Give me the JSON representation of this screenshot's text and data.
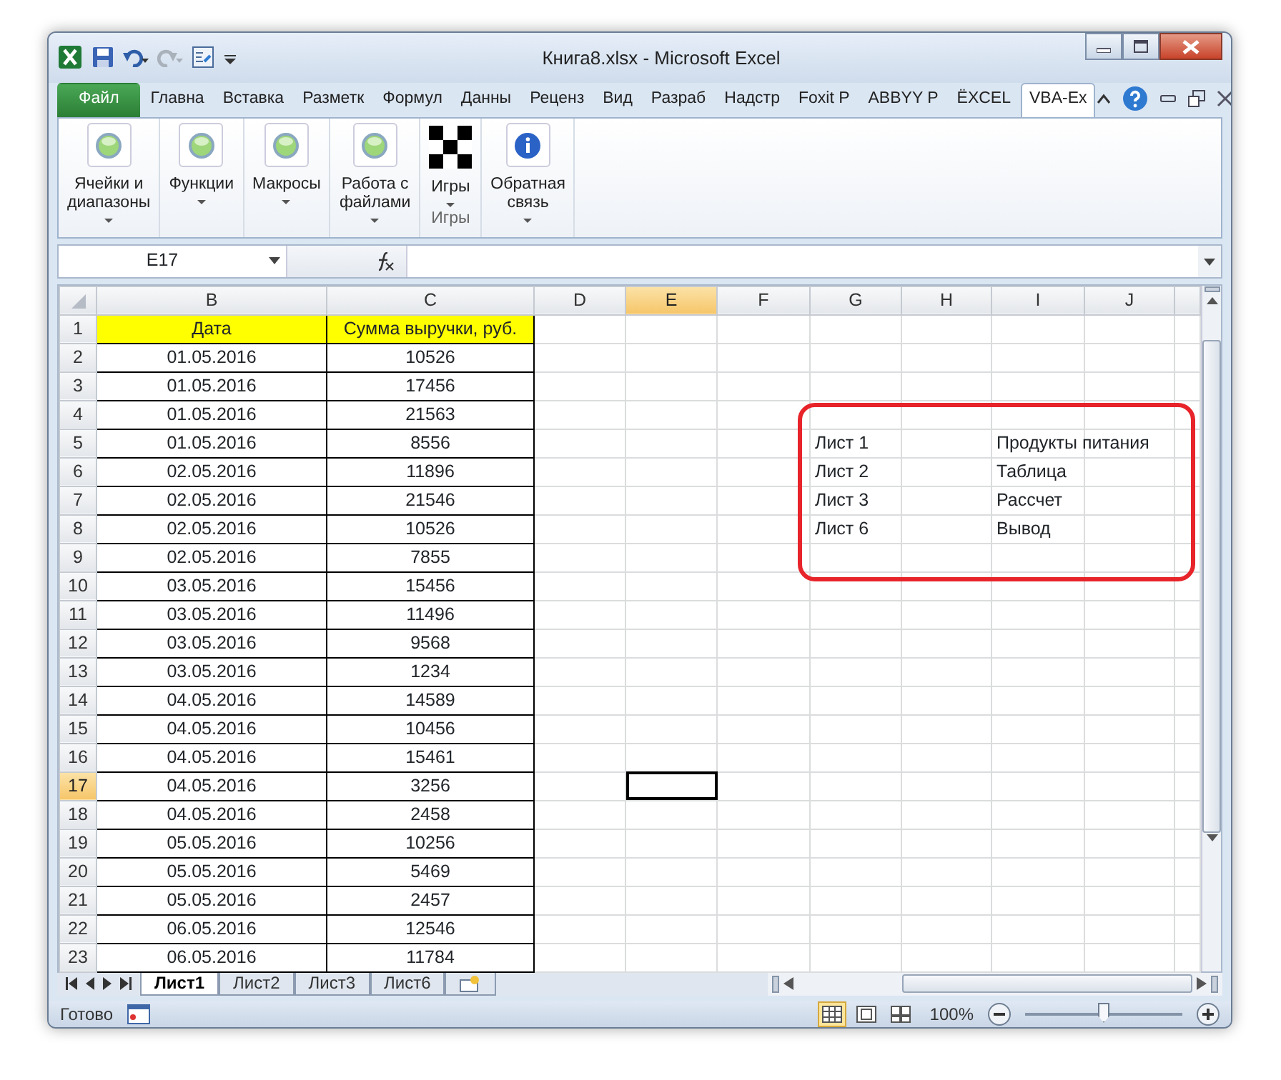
{
  "window": {
    "title": "Книга8.xlsx - Microsoft Excel"
  },
  "ribbon_tabs": [
    {
      "label": "Файл",
      "kind": "file",
      "selected": false
    },
    {
      "label": "Главна",
      "kind": "tab",
      "selected": false
    },
    {
      "label": "Вставка",
      "kind": "tab",
      "selected": false
    },
    {
      "label": "Разметк",
      "kind": "tab",
      "selected": false
    },
    {
      "label": "Формул",
      "kind": "tab",
      "selected": false
    },
    {
      "label": "Данны",
      "kind": "tab",
      "selected": false
    },
    {
      "label": "Реценз",
      "kind": "tab",
      "selected": false
    },
    {
      "label": "Вид",
      "kind": "tab",
      "selected": false
    },
    {
      "label": "Разраб",
      "kind": "tab",
      "selected": false
    },
    {
      "label": "Надстр",
      "kind": "tab",
      "selected": false
    },
    {
      "label": "Foxit P",
      "kind": "tab",
      "selected": false
    },
    {
      "label": "ABBYY P",
      "kind": "tab",
      "selected": false
    },
    {
      "label": "ЁXCEL",
      "kind": "tab",
      "selected": false
    },
    {
      "label": "VBA-Ex",
      "kind": "tab",
      "selected": true
    }
  ],
  "ribbon_groups": [
    {
      "buttons": [
        {
          "label": "Ячейки и диапазоны",
          "kind": "orb"
        }
      ]
    },
    {
      "buttons": [
        {
          "label": "Функции",
          "kind": "orb"
        }
      ]
    },
    {
      "buttons": [
        {
          "label": "Макросы",
          "kind": "orb"
        }
      ]
    },
    {
      "buttons": [
        {
          "label": "Работа с файлами",
          "kind": "orb"
        }
      ]
    },
    {
      "buttons": [
        {
          "label": "Игры",
          "kind": "checker"
        }
      ],
      "label": "Игры"
    },
    {
      "buttons": [
        {
          "label": "Обратная связь",
          "kind": "info"
        }
      ]
    }
  ],
  "formula_bar": {
    "name_box": "E17"
  },
  "columns": [
    {
      "letter": "B",
      "kind": "table",
      "selected": false
    },
    {
      "letter": "C",
      "kind": "table",
      "selected": false
    },
    {
      "letter": "D",
      "kind": "plain",
      "selected": false
    },
    {
      "letter": "E",
      "kind": "plain",
      "selected": true
    },
    {
      "letter": "F",
      "kind": "plain",
      "selected": false
    },
    {
      "letter": "G",
      "kind": "plain",
      "selected": false
    },
    {
      "letter": "H",
      "kind": "plain",
      "selected": false
    },
    {
      "letter": "I",
      "kind": "plain",
      "selected": false
    },
    {
      "letter": "J",
      "kind": "plain",
      "selected": false
    }
  ],
  "rows": [
    {
      "number": "1",
      "kind": "header",
      "selected": false,
      "cells": {
        "B": "Дата",
        "C": "Сумма выручки, руб."
      }
    },
    {
      "number": "2",
      "kind": "data",
      "selected": false,
      "cells": {
        "B": "01.05.2016",
        "C": "10526"
      }
    },
    {
      "number": "3",
      "kind": "data",
      "selected": false,
      "cells": {
        "B": "01.05.2016",
        "C": "17456"
      }
    },
    {
      "number": "4",
      "kind": "data",
      "selected": false,
      "cells": {
        "B": "01.05.2016",
        "C": "21563"
      }
    },
    {
      "number": "5",
      "kind": "data",
      "selected": false,
      "cells": {
        "B": "01.05.2016",
        "C": "8556",
        "G": "Лист 1",
        "I": "Продукты питания"
      }
    },
    {
      "number": "6",
      "kind": "data",
      "selected": false,
      "cells": {
        "B": "02.05.2016",
        "C": "11896",
        "G": "Лист 2",
        "I": "Таблица"
      }
    },
    {
      "number": "7",
      "kind": "data",
      "selected": false,
      "cells": {
        "B": "02.05.2016",
        "C": "21546",
        "G": "Лист 3",
        "I": "Рассчет"
      }
    },
    {
      "number": "8",
      "kind": "data",
      "selected": false,
      "cells": {
        "B": "02.05.2016",
        "C": "10526",
        "G": "Лист 6",
        "I": "Вывод"
      }
    },
    {
      "number": "9",
      "kind": "data",
      "selected": false,
      "cells": {
        "B": "02.05.2016",
        "C": "7855"
      }
    },
    {
      "number": "10",
      "kind": "data",
      "selected": false,
      "cells": {
        "B": "03.05.2016",
        "C": "15456"
      }
    },
    {
      "number": "11",
      "kind": "data",
      "selected": false,
      "cells": {
        "B": "03.05.2016",
        "C": "11496"
      }
    },
    {
      "number": "12",
      "kind": "data",
      "selected": false,
      "cells": {
        "B": "03.05.2016",
        "C": "9568"
      }
    },
    {
      "number": "13",
      "kind": "data",
      "selected": false,
      "cells": {
        "B": "03.05.2016",
        "C": "1234"
      }
    },
    {
      "number": "14",
      "kind": "data",
      "selected": false,
      "cells": {
        "B": "04.05.2016",
        "C": "14589"
      }
    },
    {
      "number": "15",
      "kind": "data",
      "selected": false,
      "cells": {
        "B": "04.05.2016",
        "C": "10456"
      }
    },
    {
      "number": "16",
      "kind": "data",
      "selected": false,
      "cells": {
        "B": "04.05.2016",
        "C": "15461"
      }
    },
    {
      "number": "17",
      "kind": "data",
      "selected": true,
      "cells": {
        "B": "04.05.2016",
        "C": "3256"
      }
    },
    {
      "number": "18",
      "kind": "data",
      "selected": false,
      "cells": {
        "B": "04.05.2016",
        "C": "2458"
      }
    },
    {
      "number": "19",
      "kind": "data",
      "selected": false,
      "cells": {
        "B": "05.05.2016",
        "C": "10256"
      }
    },
    {
      "number": "20",
      "kind": "data",
      "selected": false,
      "cells": {
        "B": "05.05.2016",
        "C": "5469"
      }
    },
    {
      "number": "21",
      "kind": "data",
      "selected": false,
      "cells": {
        "B": "05.05.2016",
        "C": "2457"
      }
    },
    {
      "number": "22",
      "kind": "data",
      "selected": false,
      "cells": {
        "B": "06.05.2016",
        "C": "12546"
      }
    },
    {
      "number": "23",
      "kind": "data",
      "selected": false,
      "cells": {
        "B": "06.05.2016",
        "C": "11784"
      }
    }
  ],
  "sheet_tabs": [
    {
      "label": "Лист1",
      "selected": true
    },
    {
      "label": "Лист2",
      "selected": false
    },
    {
      "label": "Лист3",
      "selected": false
    },
    {
      "label": "Лист6",
      "selected": false
    }
  ],
  "status_bar": {
    "text": "Готово",
    "views": [
      {
        "kind": "normal",
        "selected": true
      },
      {
        "kind": "layout",
        "selected": false
      },
      {
        "kind": "pagebreak",
        "selected": false
      }
    ],
    "zoom": "100%",
    "zoom_slider": {
      "level": 0.5
    }
  }
}
